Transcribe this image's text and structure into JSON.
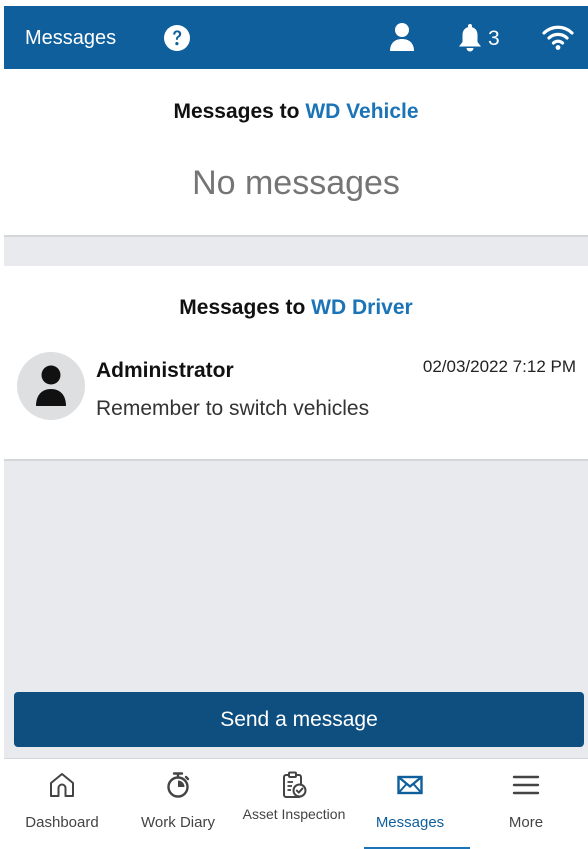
{
  "header": {
    "title": "Messages",
    "notification_count": "3"
  },
  "vehicle_section": {
    "title_prefix": "Messages to ",
    "title_target": "WD Vehicle",
    "empty_text": "No messages"
  },
  "driver_section": {
    "title_prefix": "Messages to ",
    "title_target": "WD Driver",
    "messages": [
      {
        "sender": "Administrator",
        "timestamp": "02/03/2022 7:12 PM",
        "text": "Remember to switch vehicles"
      }
    ]
  },
  "actions": {
    "send_label": "Send a message"
  },
  "nav": {
    "items": [
      {
        "label": "Dashboard",
        "icon": "home-icon"
      },
      {
        "label": "Work Diary",
        "icon": "stopwatch-icon"
      },
      {
        "label": "Asset Inspection",
        "icon": "clipboard-check-icon"
      },
      {
        "label": "Messages",
        "icon": "envelope-icon",
        "active": true
      },
      {
        "label": "More",
        "icon": "menu-icon"
      }
    ]
  },
  "colors": {
    "header_bg": "#0e5f9c",
    "accent": "#1b74b8",
    "button_bg": "#0e4f80",
    "page_bg": "#e9eaed"
  }
}
